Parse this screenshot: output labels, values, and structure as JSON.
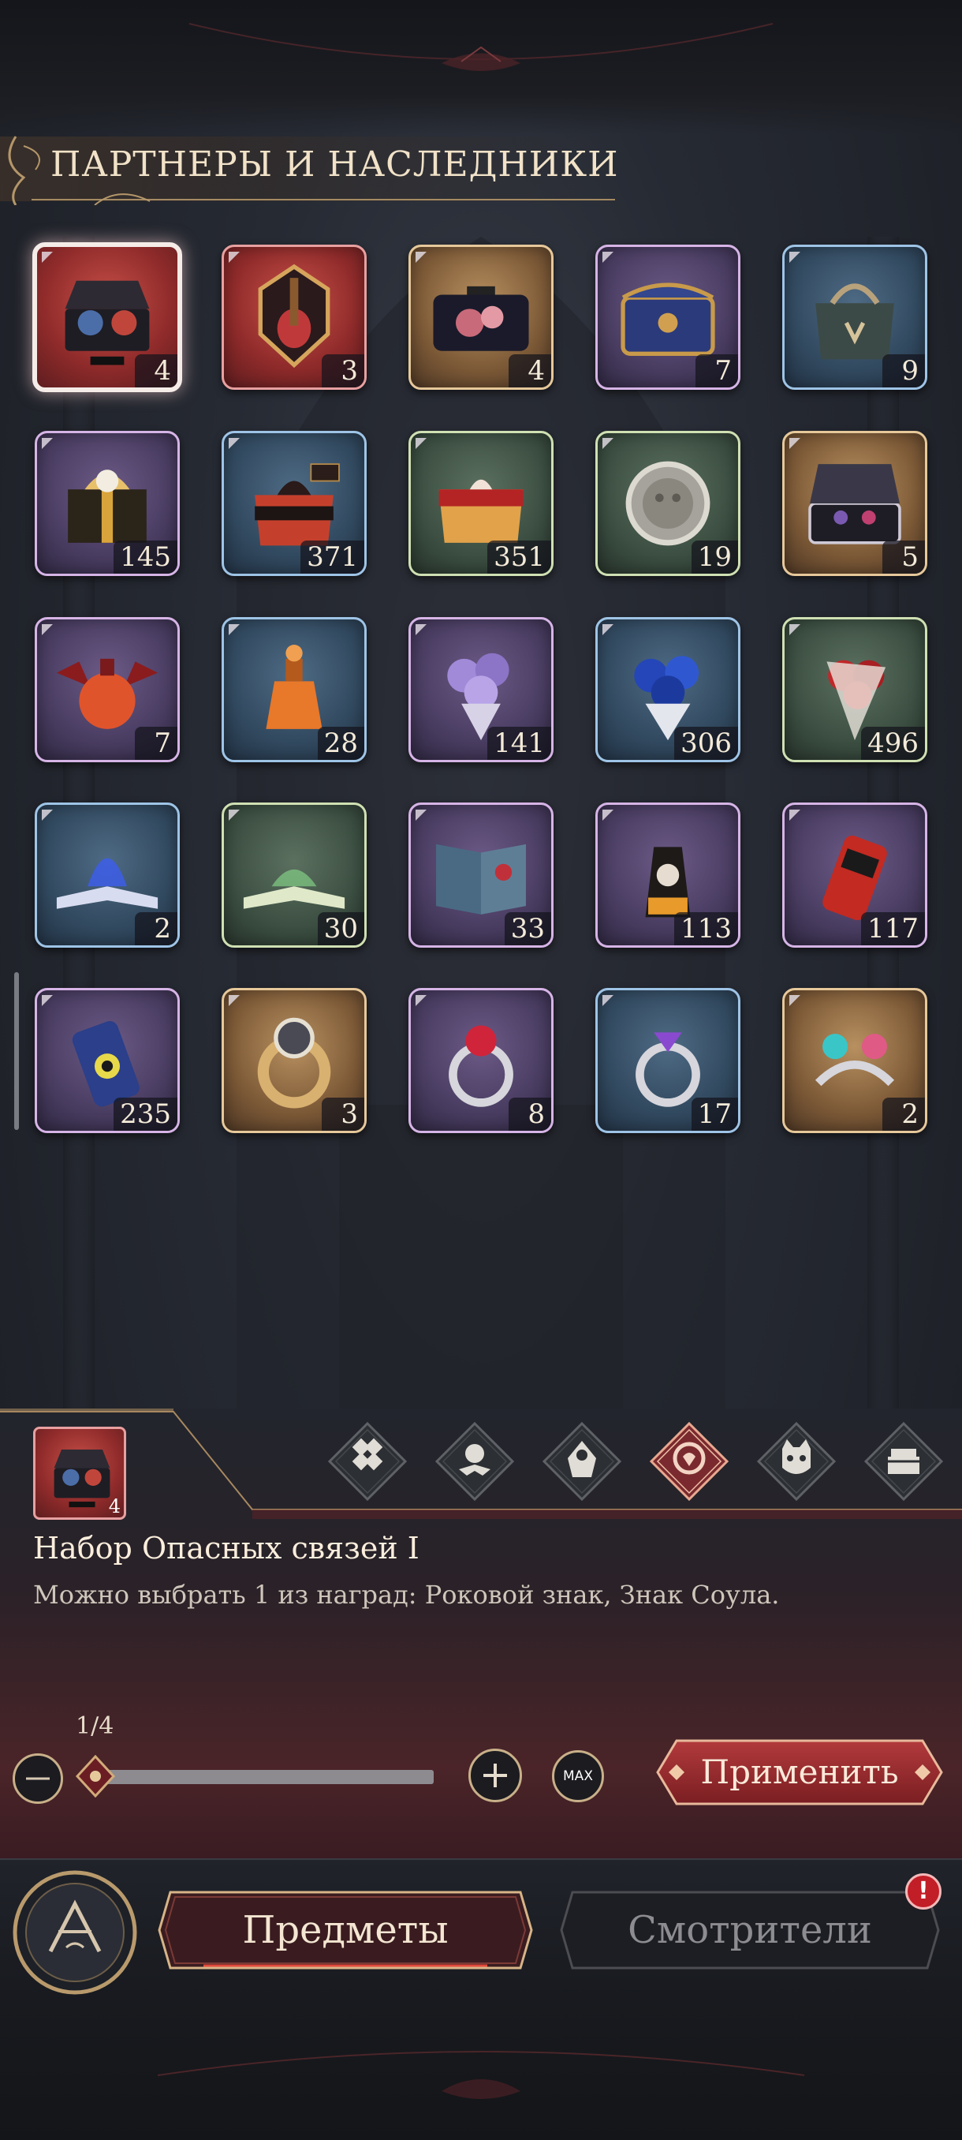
{
  "section": {
    "title": "ПАРТНЕРЫ И НАСЛЕДНИКИ"
  },
  "inventory": {
    "items": [
      {
        "icon": "gift-chest-icon",
        "rarity": "red",
        "count": "4",
        "selected": true
      },
      {
        "icon": "guitar-crest-icon",
        "rarity": "red",
        "count": "3"
      },
      {
        "icon": "floral-box-icon",
        "rarity": "gold",
        "count": "4"
      },
      {
        "icon": "blue-treasure-chest-icon",
        "rarity": "purple",
        "count": "7"
      },
      {
        "icon": "handbag-icon",
        "rarity": "blue",
        "count": "9"
      },
      {
        "icon": "gold-gift-box-icon",
        "rarity": "purple",
        "count": "145"
      },
      {
        "icon": "red-gift-box-icon",
        "rarity": "blue",
        "count": "371"
      },
      {
        "icon": "present-box-icon",
        "rarity": "green",
        "count": "351"
      },
      {
        "icon": "silver-coin-icon",
        "rarity": "green",
        "count": "19"
      },
      {
        "icon": "open-jewelry-chest-icon",
        "rarity": "gold",
        "count": "5"
      },
      {
        "icon": "winged-perfume-icon",
        "rarity": "purple",
        "count": "7"
      },
      {
        "icon": "perfume-bottle-icon",
        "rarity": "blue",
        "count": "28"
      },
      {
        "icon": "purple-bouquet-icon",
        "rarity": "purple",
        "count": "141"
      },
      {
        "icon": "blue-rose-bouquet-icon",
        "rarity": "blue",
        "count": "306"
      },
      {
        "icon": "red-rose-bouquet-icon",
        "rarity": "green",
        "count": "496"
      },
      {
        "icon": "blue-magic-book-icon",
        "rarity": "blue",
        "count": "2"
      },
      {
        "icon": "green-magic-book-icon",
        "rarity": "green",
        "count": "30"
      },
      {
        "icon": "art-book-icon",
        "rarity": "purple",
        "count": "33"
      },
      {
        "icon": "drink-bottle-icon",
        "rarity": "purple",
        "count": "113"
      },
      {
        "icon": "red-can-icon",
        "rarity": "purple",
        "count": "117"
      },
      {
        "icon": "blue-can-icon",
        "rarity": "purple",
        "count": "235"
      },
      {
        "icon": "gold-gem-ring-icon",
        "rarity": "gold",
        "count": "3"
      },
      {
        "icon": "ruby-ring-icon",
        "rarity": "purple",
        "count": "8"
      },
      {
        "icon": "amethyst-ring-icon",
        "rarity": "blue",
        "count": "17"
      },
      {
        "icon": "twin-gem-ring-icon",
        "rarity": "gold",
        "count": "2"
      }
    ]
  },
  "detail": {
    "thumb_count": "4",
    "item_name": "Набор Опасных связей I",
    "description": "Можно выбрать 1 из наград: Роковой знак, Знак Соула.",
    "categories": [
      {
        "icon": "diamond-grid-icon",
        "active": false
      },
      {
        "icon": "lotus-bat-icon",
        "active": false
      },
      {
        "icon": "cloak-figure-icon",
        "active": false
      },
      {
        "icon": "heart-lock-icon",
        "active": true
      },
      {
        "icon": "cat-face-icon",
        "active": false
      },
      {
        "icon": "cake-icon",
        "active": false
      }
    ]
  },
  "quantity": {
    "label": "1/4",
    "current": 1,
    "max": 4,
    "max_label": "MAX"
  },
  "actions": {
    "apply_label": "Применить"
  },
  "nav": {
    "tab_items": "Предметы",
    "tab_keepers": "Смотрители",
    "alert": "!"
  },
  "colors": {
    "accent_gold": "#c9b089",
    "apply_red": "#9e2a2c",
    "alert_red": "#c21e27"
  }
}
